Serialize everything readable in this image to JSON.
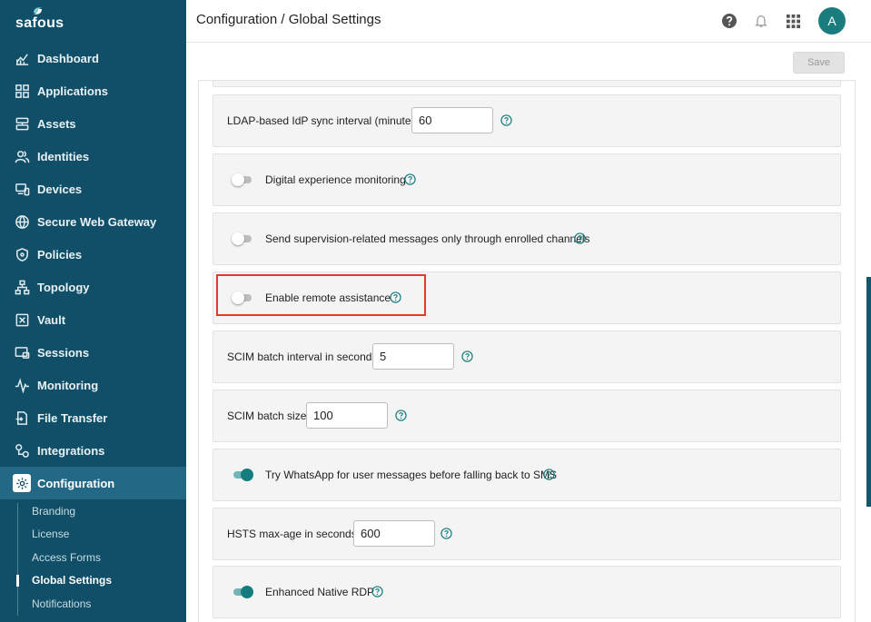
{
  "brand": {
    "name": "safous"
  },
  "sidebar": {
    "items": [
      {
        "label": "Dashboard",
        "icon": "chart-icon"
      },
      {
        "label": "Applications",
        "icon": "grid-icon"
      },
      {
        "label": "Assets",
        "icon": "server-icon"
      },
      {
        "label": "Identities",
        "icon": "users-icon"
      },
      {
        "label": "Devices",
        "icon": "devices-icon"
      },
      {
        "label": "Secure Web Gateway",
        "icon": "globe-icon"
      },
      {
        "label": "Policies",
        "icon": "shield-icon"
      },
      {
        "label": "Topology",
        "icon": "topology-icon"
      },
      {
        "label": "Vault",
        "icon": "vault-icon"
      },
      {
        "label": "Sessions",
        "icon": "sessions-icon"
      },
      {
        "label": "Monitoring",
        "icon": "pulse-icon"
      },
      {
        "label": "File Transfer",
        "icon": "file-transfer-icon"
      },
      {
        "label": "Integrations",
        "icon": "integrations-icon"
      },
      {
        "label": "Configuration",
        "icon": "gear-icon",
        "active": true
      }
    ],
    "sub_items": [
      {
        "label": "Branding"
      },
      {
        "label": "License"
      },
      {
        "label": "Access Forms"
      },
      {
        "label": "Global Settings",
        "active": true
      },
      {
        "label": "Notifications"
      }
    ]
  },
  "header": {
    "breadcrumb_parent": "Configuration",
    "breadcrumb_sep": " / ",
    "breadcrumb_current": "Global Settings",
    "avatar_initial": "A"
  },
  "toolbar": {
    "save_label": "Save"
  },
  "settings": [
    {
      "type": "input",
      "label": "LDAP-based IdP sync interval (minutes)",
      "value": "60"
    },
    {
      "type": "toggle",
      "label": "Digital experience monitoring",
      "on": false
    },
    {
      "type": "toggle",
      "label": "Send supervision-related messages only through enrolled channels",
      "on": false
    },
    {
      "type": "toggle",
      "label": "Enable remote assistance",
      "on": false,
      "highlighted": true
    },
    {
      "type": "input",
      "label": "SCIM batch interval in seconds",
      "value": "5"
    },
    {
      "type": "input",
      "label": "SCIM batch size",
      "value": "100"
    },
    {
      "type": "toggle",
      "label": "Try WhatsApp for user messages before falling back to SMS",
      "on": true
    },
    {
      "type": "input",
      "label": "HSTS max-age in seconds",
      "value": "600"
    },
    {
      "type": "toggle",
      "label": "Enhanced Native RDP",
      "on": true
    }
  ],
  "colors": {
    "sidebar_bg": "#114f68",
    "accent": "#167d7e",
    "highlight_border": "#e23b2a"
  }
}
